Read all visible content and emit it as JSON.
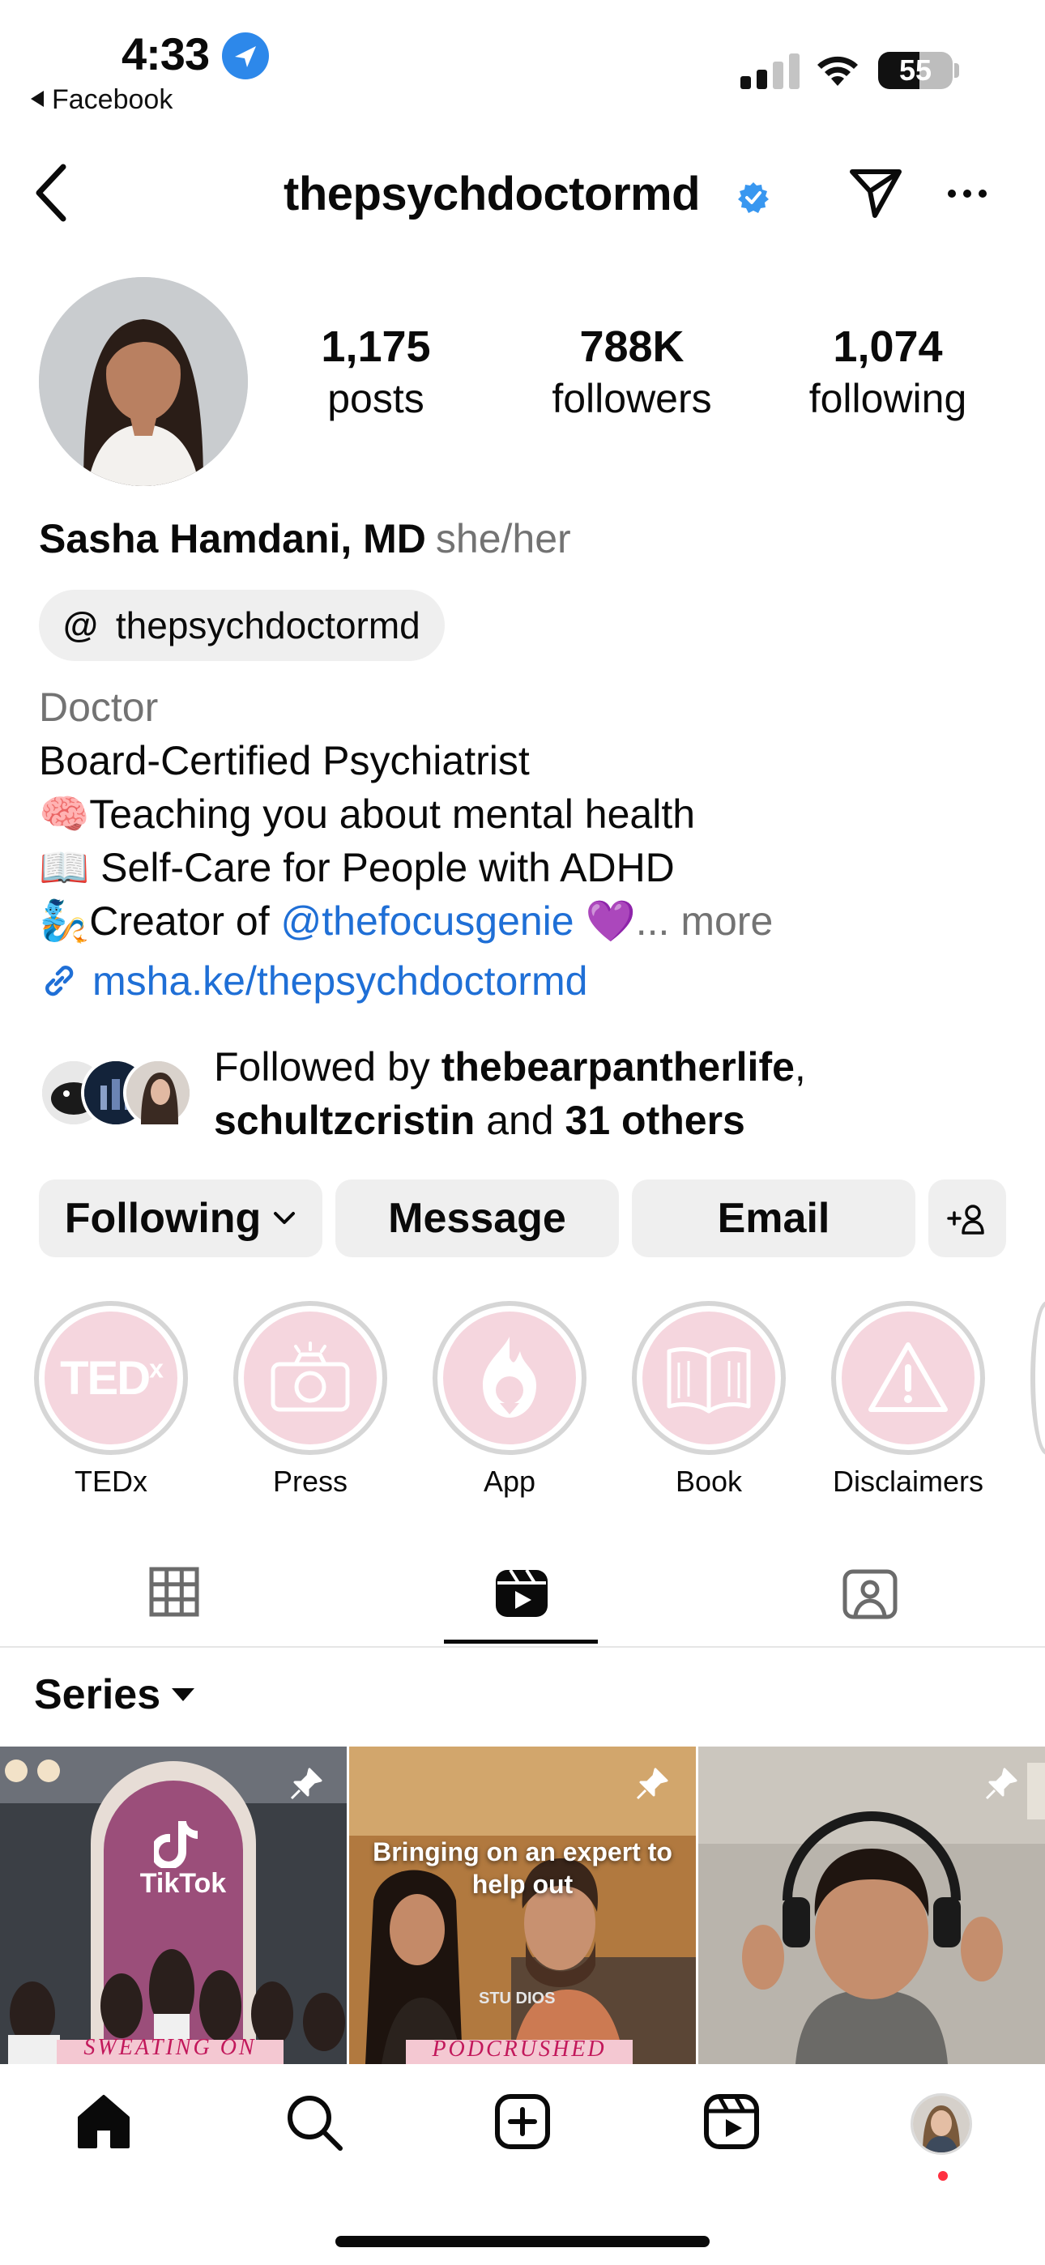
{
  "status_bar": {
    "time": "4:33",
    "back_app": "Facebook",
    "battery": "55",
    "battery_level": 0.55
  },
  "header": {
    "username": "thepsychdoctormd"
  },
  "profile": {
    "stats": [
      {
        "value": "1,175",
        "label": "posts"
      },
      {
        "value": "788K",
        "label": "followers"
      },
      {
        "value": "1,074",
        "label": "following"
      }
    ],
    "name": "Sasha Hamdani, MD",
    "pronouns": "she/her",
    "threads_handle": "thepsychdoctormd",
    "category": "Doctor",
    "bio": {
      "line1": "Board-Certified Psychiatrist",
      "line2_emoji": "🧠",
      "line2": "Teaching you about mental health",
      "line3_emoji": "📖",
      "line3": "Self-Care for People with ADHD",
      "line4_emoji": "🧞",
      "line4_prefix": "Creator of ",
      "line4_mention": "@thefocusgenie",
      "line4_emoji2": "💜",
      "more": "... more"
    },
    "link": "msha.ke/thepsychdoctormd",
    "followed_by": {
      "prefix": "Followed by ",
      "user1": "thebearpantherlife",
      "sep": ",",
      "user2": "schultzcristin",
      "mid": " and ",
      "others": "31 others"
    }
  },
  "actions": {
    "following": "Following",
    "message": "Message",
    "email": "Email"
  },
  "highlights": [
    {
      "label": "TEDx",
      "icon": "tedx-icon"
    },
    {
      "label": "Press",
      "icon": "camera-icon"
    },
    {
      "label": "App",
      "icon": "genie-icon"
    },
    {
      "label": "Book",
      "icon": "book-icon"
    },
    {
      "label": "Disclaimers",
      "icon": "warning-icon"
    }
  ],
  "series": {
    "label": "Series"
  },
  "thumbs": [
    {
      "logo": "TikTok",
      "caption": "SWEATING ON"
    },
    {
      "caption": "Bringing on an expert to help out",
      "caption2": "PODCRUSHED",
      "sign": "STU      DIOS"
    },
    {
      "caption": ""
    }
  ],
  "colors": {
    "link": "#1f6fd6",
    "verified": "#3897f0",
    "highlight_fill": "#f5d6de",
    "notification": "#ff3040"
  }
}
